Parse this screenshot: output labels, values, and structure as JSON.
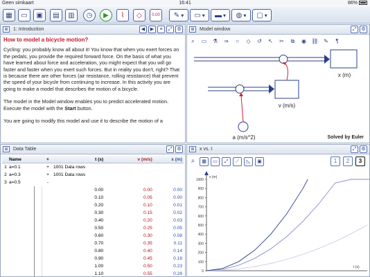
{
  "status": {
    "carrier": "Geen simkaart",
    "time": "16:41",
    "battery": "86%"
  },
  "toolbar": {
    "buttons": [
      "grid",
      "folder",
      "save",
      "table",
      "calculator",
      "timer",
      "play",
      "chart",
      "model",
      "0.00"
    ],
    "dropdowns": [
      "pen",
      "layout",
      "window",
      "globe",
      "doc"
    ]
  },
  "intro": {
    "title": "1: Introduction",
    "heading": "How to model a bicycle motion?",
    "p1": "Cycling: you probably know all about it! You know that when you exert forces on the pedals, you provide the required forward force. On the basis of what you have learned about force and acceleration, you might expect that you will go faster and faster when you exert such forces. But in reality you don't, right? That is because there are other forces (air resistance, rolling resistance) that prevent the speed of your bicycle from continuing to increase. In this activity you are going to make a model that describes the motion of a bicycle.",
    "p2a": "The model in the Model window enables you to predict accelerated motion. Execute the model with the ",
    "p2b": "Start",
    "p2c": " button.",
    "p3": "You are going to modify this model and use it to describe the motion of a"
  },
  "model": {
    "title": "Model window",
    "x_label": "x (m)",
    "v_label": "v (m/s)",
    "a_label": "a (m/s^2)",
    "solver": "Solved by Euler"
  },
  "table": {
    "title": "Data Table",
    "headers": {
      "name": "Name",
      "pm": "+",
      "t": "t (s)",
      "v": "v (m/s)",
      "x": "x (m)"
    },
    "runs": [
      {
        "n": "1",
        "name": "a=0.1",
        "pm": "+",
        "info": "1001 Data rows"
      },
      {
        "n": "2",
        "name": "a=0.3",
        "pm": "+",
        "info": "1001 Data rows"
      },
      {
        "n": "3",
        "name": "a=0.5",
        "pm": "-"
      }
    ],
    "rows": [
      [
        "0.00",
        "0.00",
        "0.00"
      ],
      [
        "0.10",
        "0.05",
        "0.00"
      ],
      [
        "0.20",
        "0.10",
        "0.01"
      ],
      [
        "0.30",
        "0.15",
        "0.02"
      ],
      [
        "0.40",
        "0.20",
        "0.03"
      ],
      [
        "0.50",
        "0.25",
        "0.05"
      ],
      [
        "0.60",
        "0.30",
        "0.08"
      ],
      [
        "0.70",
        "0.35",
        "0.11"
      ],
      [
        "0.80",
        "0.40",
        "0.14"
      ],
      [
        "0.90",
        "0.45",
        "0.18"
      ],
      [
        "1.00",
        "0.50",
        "0.23"
      ],
      [
        "1.10",
        "0.55",
        "0.28"
      ]
    ]
  },
  "graph": {
    "title": "x vs. t",
    "pages": [
      "1",
      "2",
      "3"
    ],
    "selected_page": "3"
  },
  "chart_data": {
    "type": "line",
    "xlabel": "t (s)",
    "ylabel": "x (m)",
    "ylim": [
      0,
      1000
    ],
    "y_ticks": [
      0,
      100,
      200,
      300,
      400,
      500,
      600,
      700,
      800,
      900,
      1000
    ],
    "x_range_units": [
      0,
      100
    ],
    "series": [
      {
        "x": [
          0,
          10,
          20,
          30,
          40,
          50,
          60,
          70,
          80,
          90,
          100
        ],
        "values": [
          0,
          5,
          20,
          45,
          80,
          125,
          180,
          245,
          320,
          405,
          500
        ],
        "color": "#c9c9e8"
      },
      {
        "x": [
          0,
          10,
          20,
          30,
          40,
          50,
          60,
          70,
          80,
          90,
          100,
          105
        ],
        "values": [
          0,
          15,
          60,
          135,
          240,
          375,
          540,
          735,
          960,
          1000,
          1000,
          1000
        ],
        "color": "#8a8ad0"
      },
      {
        "x": [
          0,
          10,
          20,
          30,
          40,
          50,
          60,
          63
        ],
        "values": [
          0,
          25,
          100,
          225,
          400,
          625,
          900,
          1000
        ],
        "color": "#2a3f8a"
      }
    ]
  }
}
